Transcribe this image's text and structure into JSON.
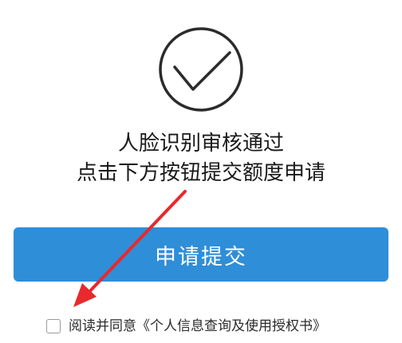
{
  "status": {
    "icon": "check-circle-icon",
    "line1": "人脸识别审核通过",
    "line2": "点击下方按钮提交额度申请"
  },
  "submit": {
    "label": "申请提交",
    "color": "#2f8ed8"
  },
  "agreement": {
    "checked": false,
    "prefix": "阅读并同意",
    "link_text": "《个人信息查询及使用授权书》"
  },
  "annotation": {
    "icon": "red-arrow-icon",
    "color": "#e8292d"
  }
}
